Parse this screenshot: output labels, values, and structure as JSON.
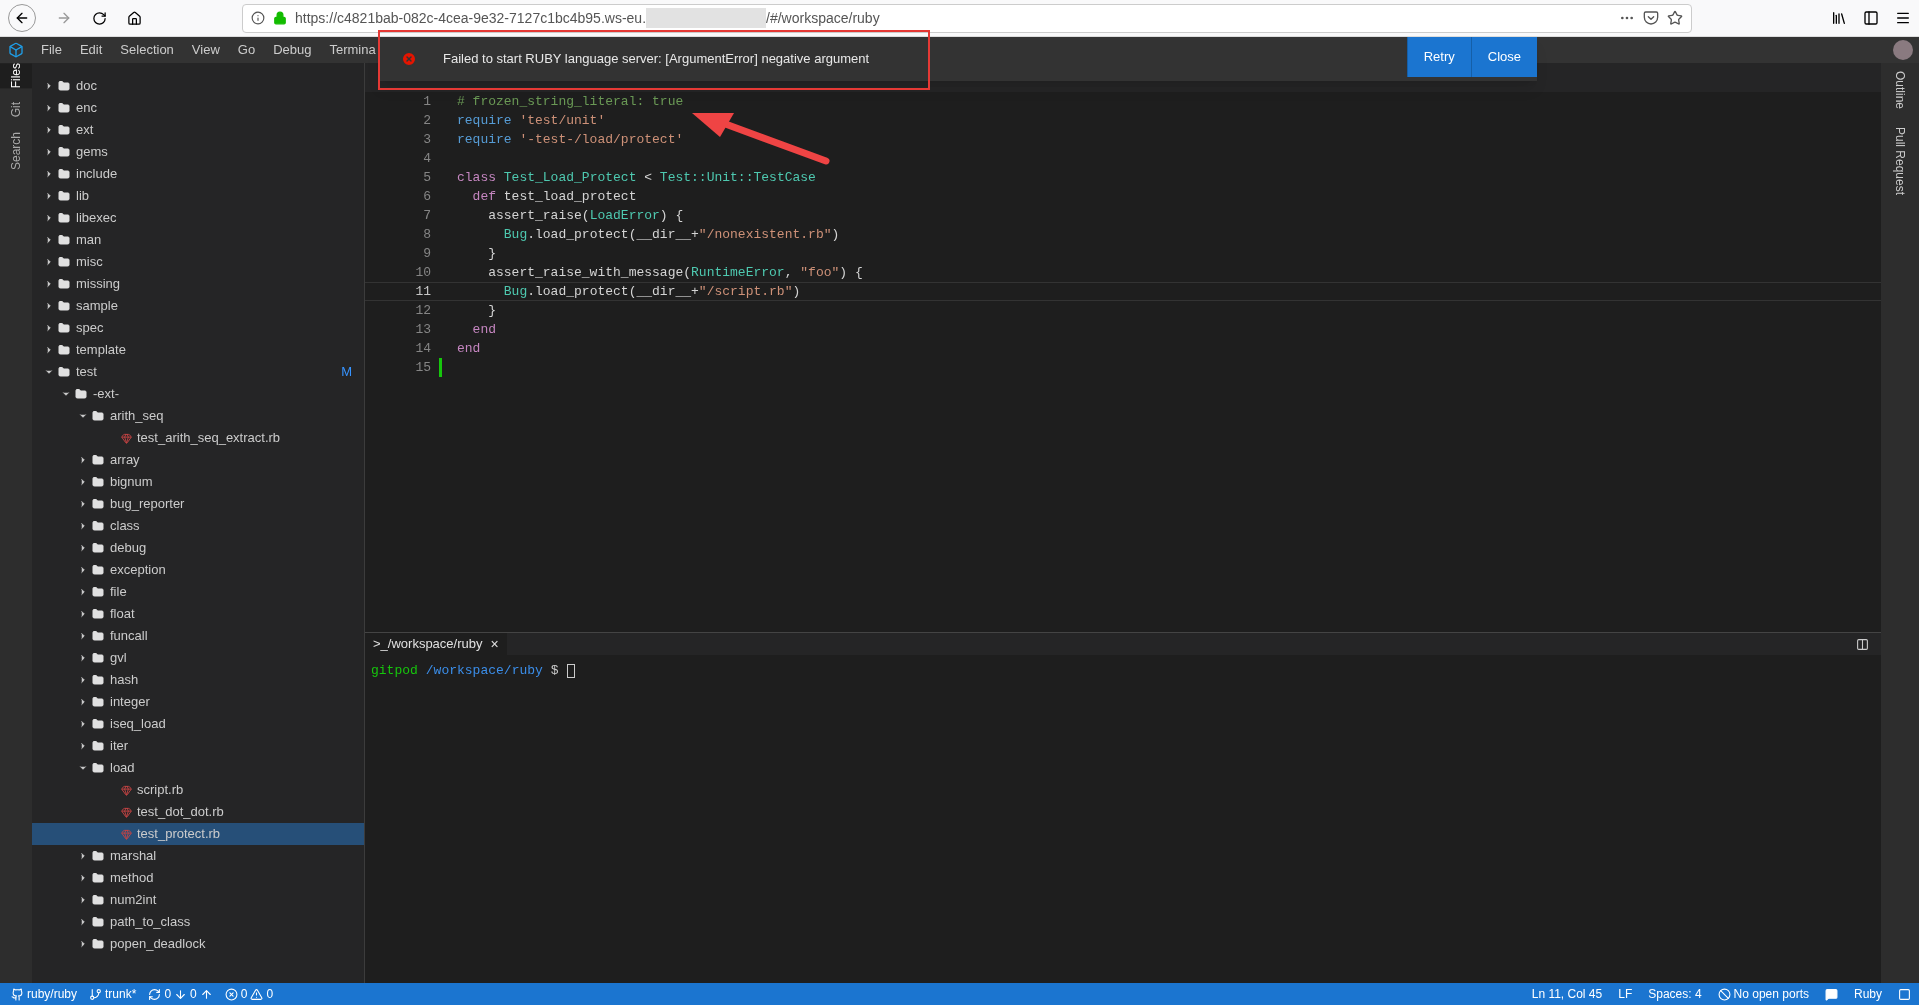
{
  "browser": {
    "url_start": "https://c4821bab-082c-4cea-9e32-7127c1bc4b95.ws-eu.",
    "url_end": "/#/workspace/ruby"
  },
  "menu": [
    "File",
    "Edit",
    "Selection",
    "View",
    "Go",
    "Debug",
    "Termina"
  ],
  "activity_left": [
    {
      "label": "Files",
      "selected": true
    },
    {
      "label": "Git",
      "selected": false
    },
    {
      "label": "Search",
      "selected": false
    }
  ],
  "activity_right": [
    "Outline",
    "Pull Request"
  ],
  "tree": [
    {
      "name": "doc",
      "kind": "folder",
      "expanded": false
    },
    {
      "name": "enc",
      "kind": "folder",
      "expanded": false
    },
    {
      "name": "ext",
      "kind": "folder",
      "expanded": false
    },
    {
      "name": "gems",
      "kind": "folder",
      "expanded": false
    },
    {
      "name": "include",
      "kind": "folder",
      "expanded": false
    },
    {
      "name": "lib",
      "kind": "folder",
      "expanded": false
    },
    {
      "name": "libexec",
      "kind": "folder",
      "expanded": false
    },
    {
      "name": "man",
      "kind": "folder",
      "expanded": false
    },
    {
      "name": "misc",
      "kind": "folder",
      "expanded": false
    },
    {
      "name": "missing",
      "kind": "folder",
      "expanded": false
    },
    {
      "name": "sample",
      "kind": "folder",
      "expanded": false
    },
    {
      "name": "spec",
      "kind": "folder",
      "expanded": false
    },
    {
      "name": "template",
      "kind": "folder",
      "expanded": false
    },
    {
      "name": "test",
      "kind": "folder",
      "expanded": true,
      "badge": "M",
      "children": [
        {
          "name": "-ext-",
          "kind": "folder",
          "expanded": true,
          "children": [
            {
              "name": "arith_seq",
              "kind": "folder",
              "expanded": true,
              "children": [
                {
                  "name": "test_arith_seq_extract.rb",
                  "kind": "file",
                  "selected": false
                }
              ]
            },
            {
              "name": "array",
              "kind": "folder",
              "expanded": false
            },
            {
              "name": "bignum",
              "kind": "folder",
              "expanded": false
            },
            {
              "name": "bug_reporter",
              "kind": "folder",
              "expanded": false
            },
            {
              "name": "class",
              "kind": "folder",
              "expanded": false
            },
            {
              "name": "debug",
              "kind": "folder",
              "expanded": false
            },
            {
              "name": "exception",
              "kind": "folder",
              "expanded": false
            },
            {
              "name": "file",
              "kind": "folder",
              "expanded": false
            },
            {
              "name": "float",
              "kind": "folder",
              "expanded": false
            },
            {
              "name": "funcall",
              "kind": "folder",
              "expanded": false
            },
            {
              "name": "gvl",
              "kind": "folder",
              "expanded": false
            },
            {
              "name": "hash",
              "kind": "folder",
              "expanded": false
            },
            {
              "name": "integer",
              "kind": "folder",
              "expanded": false
            },
            {
              "name": "iseq_load",
              "kind": "folder",
              "expanded": false
            },
            {
              "name": "iter",
              "kind": "folder",
              "expanded": false
            },
            {
              "name": "load",
              "kind": "folder",
              "expanded": true,
              "children": [
                {
                  "name": "script.rb",
                  "kind": "file",
                  "selected": false
                },
                {
                  "name": "test_dot_dot.rb",
                  "kind": "file",
                  "selected": false
                },
                {
                  "name": "test_protect.rb",
                  "kind": "file",
                  "selected": true
                }
              ]
            },
            {
              "name": "marshal",
              "kind": "folder",
              "expanded": false
            },
            {
              "name": "method",
              "kind": "folder",
              "expanded": false
            },
            {
              "name": "num2int",
              "kind": "folder",
              "expanded": false
            },
            {
              "name": "path_to_class",
              "kind": "folder",
              "expanded": false
            },
            {
              "name": "popen_deadlock",
              "kind": "folder",
              "expanded": false
            }
          ]
        }
      ]
    }
  ],
  "code": [
    {
      "number": "1",
      "current": false,
      "tokens": [
        {
          "text": "# frozen_string_literal: true",
          "kind": "comment"
        }
      ]
    },
    {
      "number": "2",
      "current": false,
      "tokens": [
        {
          "text": "require",
          "kind": "keyword"
        },
        {
          "text": " 'test/unit'",
          "kind": "string"
        }
      ]
    },
    {
      "number": "3",
      "current": false,
      "tokens": [
        {
          "text": "require",
          "kind": "keyword"
        },
        {
          "text": " '-test-/load/protect'",
          "kind": "string"
        }
      ]
    },
    {
      "number": "4",
      "current": false
    },
    {
      "number": "5",
      "current": false,
      "tokens": [
        {
          "text": "class",
          "kind": "control"
        },
        {
          "text": " Test_Load_Protect",
          "kind": "type"
        },
        {
          "text": " < ",
          "kind": "plain"
        },
        {
          "text": "Test::Unit::TestCase",
          "kind": "type"
        }
      ]
    },
    {
      "number": "6",
      "current": false,
      "tokens": [
        {
          "text": "  def",
          "kind": "control"
        },
        {
          "text": " test_load_protect",
          "kind": "plain"
        }
      ]
    },
    {
      "number": "7",
      "current": false,
      "tokens": [
        {
          "text": "    assert_raise(",
          "kind": "plain"
        },
        {
          "text": "LoadError",
          "kind": "type"
        },
        {
          "text": ") {",
          "kind": "plain"
        }
      ]
    },
    {
      "number": "8",
      "current": false,
      "tokens": [
        {
          "text": "      Bug",
          "kind": "type"
        },
        {
          "text": ".load_protect(__dir__+",
          "kind": "plain"
        },
        {
          "text": "\"/nonexistent.rb\"",
          "kind": "string"
        },
        {
          "text": ")",
          "kind": "plain"
        }
      ]
    },
    {
      "number": "9",
      "current": false,
      "tokens": [
        {
          "text": "    }",
          "kind": "plain"
        }
      ]
    },
    {
      "number": "10",
      "current": false,
      "tokens": [
        {
          "text": "    assert_raise_with_message(",
          "kind": "plain"
        },
        {
          "text": "RuntimeError",
          "kind": "type"
        },
        {
          "text": ", ",
          "kind": "plain"
        },
        {
          "text": "\"foo\"",
          "kind": "string"
        },
        {
          "text": ") {",
          "kind": "plain"
        }
      ]
    },
    {
      "number": "11",
      "current": true,
      "tokens": [
        {
          "text": "      Bug",
          "kind": "type"
        },
        {
          "text": ".load_protect(__dir__+",
          "kind": "plain"
        },
        {
          "text": "\"/script.rb\"",
          "kind": "string"
        },
        {
          "text": ")",
          "kind": "plain"
        }
      ]
    },
    {
      "number": "12",
      "current": false,
      "tokens": [
        {
          "text": "    }",
          "kind": "plain"
        }
      ]
    },
    {
      "number": "13",
      "current": false,
      "tokens": [
        {
          "text": "  end",
          "kind": "control"
        }
      ]
    },
    {
      "number": "14",
      "current": false,
      "tokens": [
        {
          "text": "end",
          "kind": "control"
        }
      ]
    },
    {
      "number": "15",
      "current": false,
      "added": true
    }
  ],
  "notification": {
    "message": "Failed to start RUBY language server: [ArgumentError] negative argument",
    "buttons": [
      "Retry",
      "Close"
    ]
  },
  "terminal": {
    "tab": "/workspace/ruby",
    "tab_prefix": ">_",
    "close": "×",
    "prompt_user": "gitpod",
    "prompt_path": "/workspace/ruby",
    "prompt_sign": "$"
  },
  "status_left": [
    {
      "kind": "repo",
      "text": "ruby/ruby"
    },
    {
      "kind": "branch",
      "text": "trunk*"
    },
    {
      "kind": "sync",
      "text": "0"
    },
    {
      "kind": "down",
      "text": "0"
    },
    {
      "kind": "up"
    },
    {
      "kind": "errors",
      "text": "0"
    },
    {
      "kind": "warnings",
      "text": "0"
    }
  ],
  "status_right": [
    {
      "kind": "text",
      "text": "Ln 11, Col 45"
    },
    {
      "kind": "text",
      "text": "LF"
    },
    {
      "kind": "text",
      "text": "Spaces: 4"
    },
    {
      "kind": "ports",
      "text": "No open ports"
    },
    {
      "kind": "chat"
    },
    {
      "kind": "text",
      "text": "Ruby"
    },
    {
      "kind": "panel"
    }
  ]
}
